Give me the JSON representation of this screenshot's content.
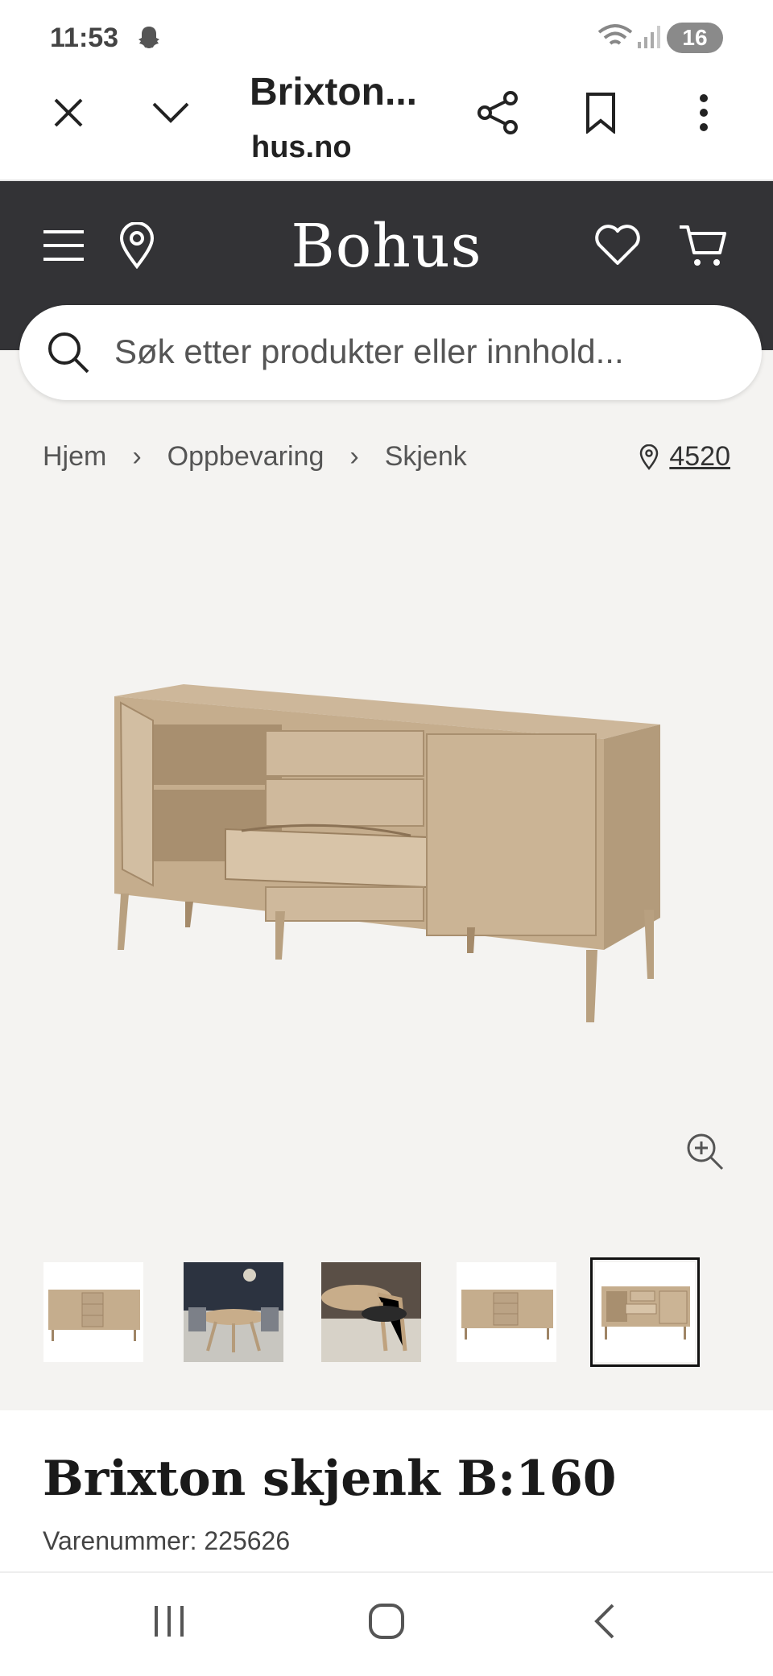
{
  "status_bar": {
    "time": "11:53",
    "battery": "16"
  },
  "browser": {
    "title": "Brixton...",
    "url": "hus.no"
  },
  "header": {
    "logo": "Bohus"
  },
  "search": {
    "placeholder": "Søk etter produkter eller innhold..."
  },
  "breadcrumb": [
    "Hjem",
    "Oppbevaring",
    "Skjenk"
  ],
  "store": {
    "number": "4520"
  },
  "product": {
    "title": "Brixton skjenk B:160",
    "sku": "Varenummer: 225626"
  },
  "thumbnails": {
    "count": 5,
    "selected_index": 4
  },
  "colors": {
    "header_bg": "#333336",
    "page_bg": "#f4f3f1",
    "wood": "#c9b497"
  }
}
